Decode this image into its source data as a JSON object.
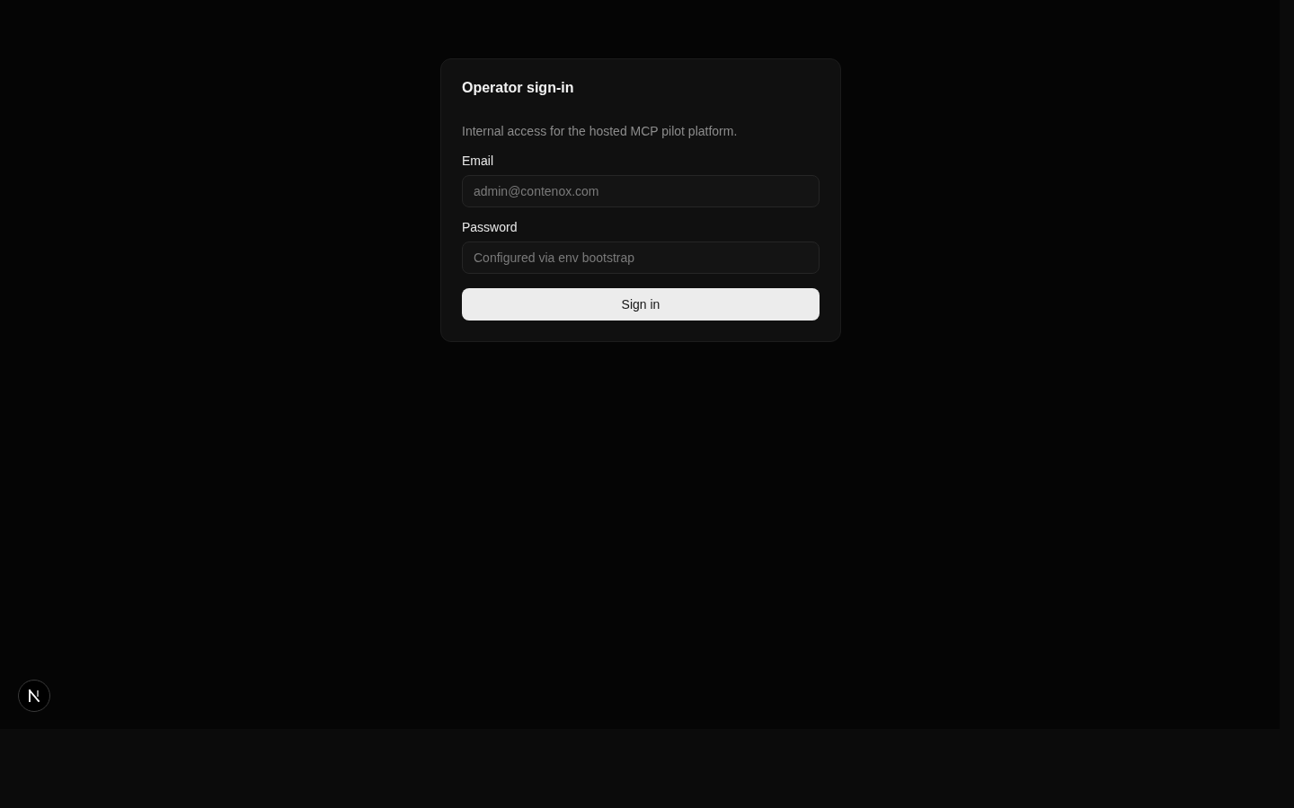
{
  "card": {
    "title": "Operator sign-in",
    "description": "Internal access for the hosted MCP pilot platform.",
    "fields": [
      {
        "label": "Email",
        "placeholder": "admin@contenox.com"
      },
      {
        "label": "Password",
        "placeholder": "Configured via env bootstrap"
      }
    ],
    "submit_button": "Sign in"
  }
}
